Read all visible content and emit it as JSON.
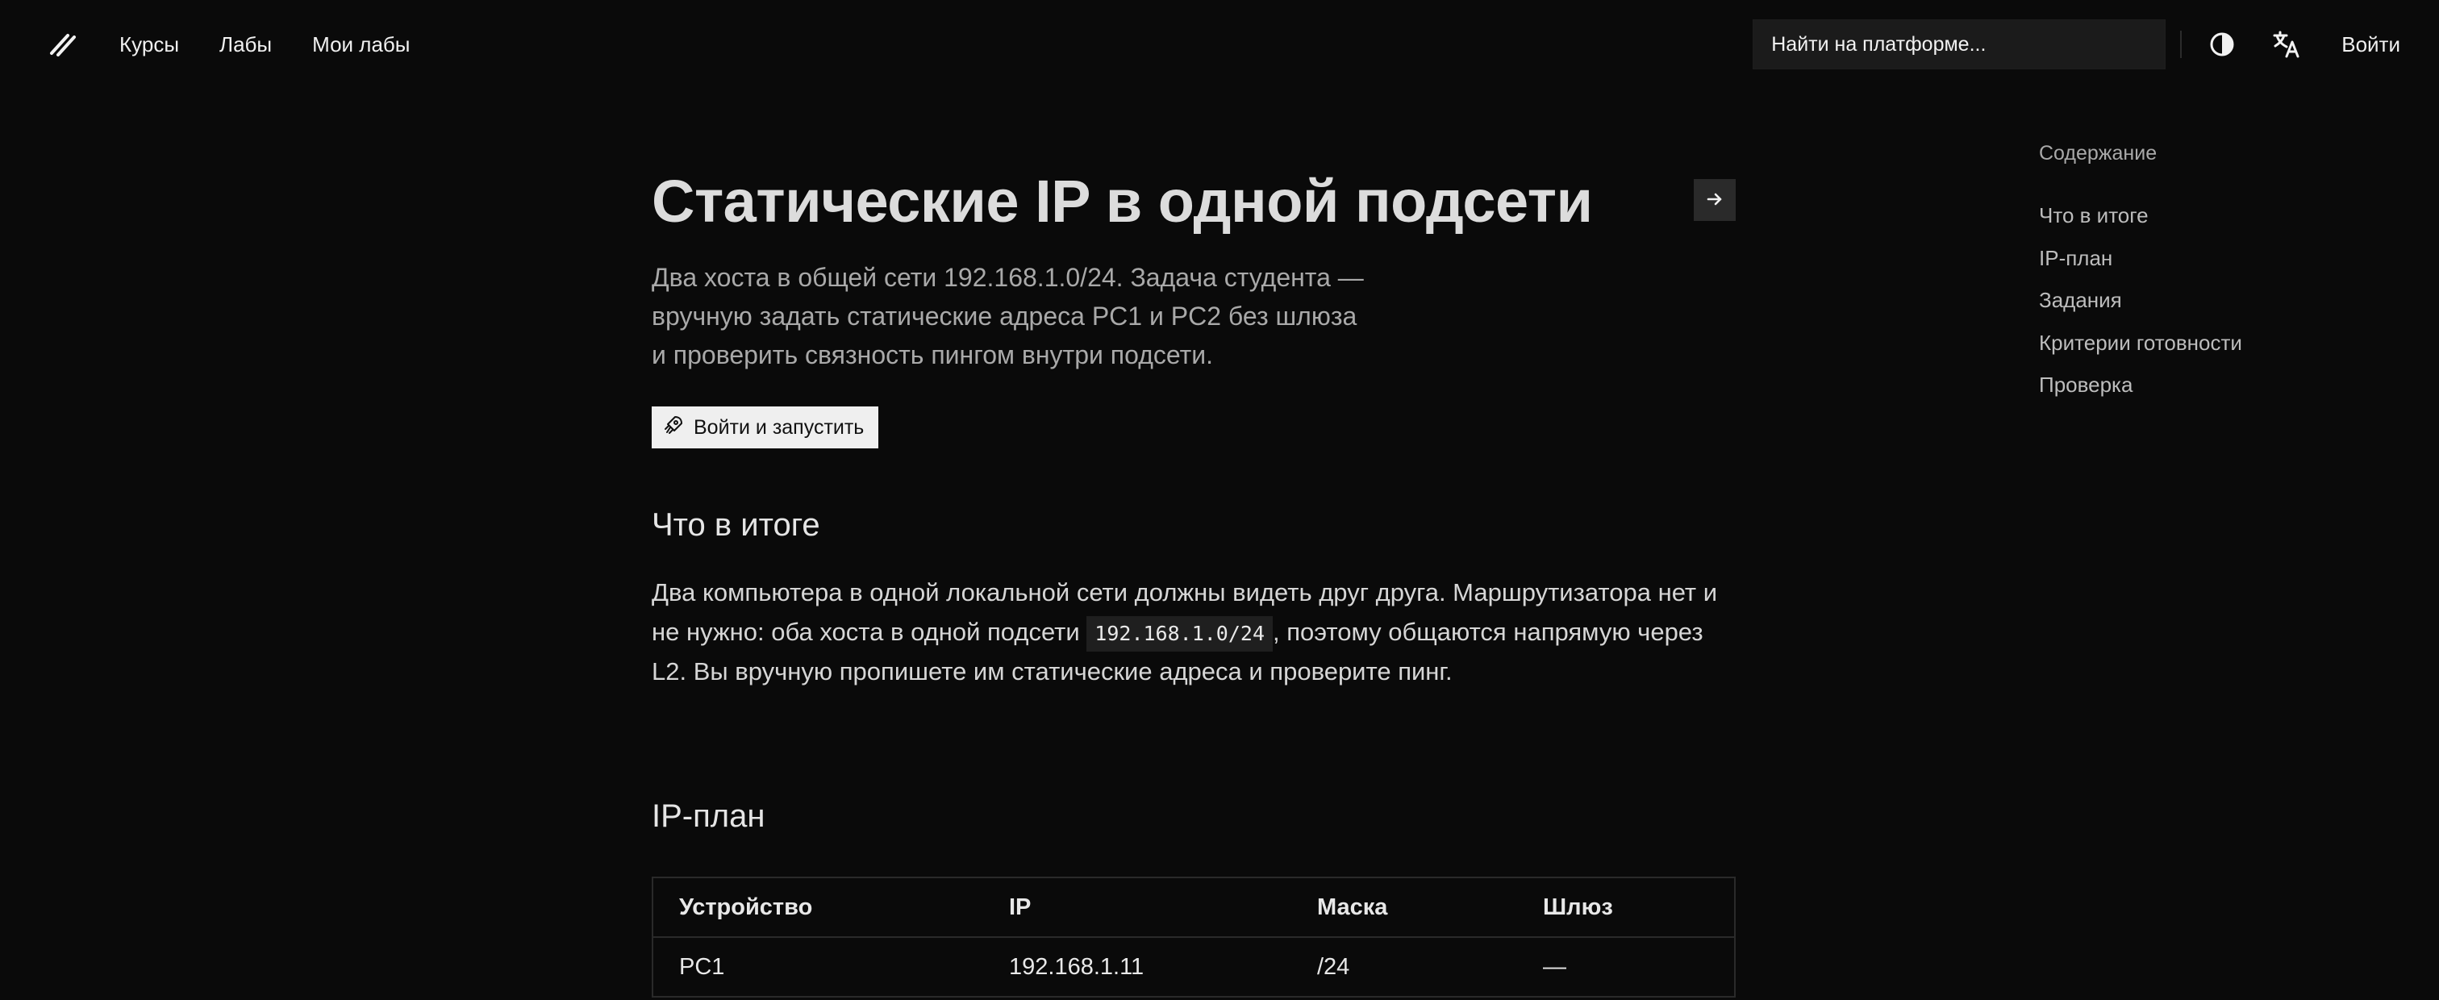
{
  "header": {
    "nav": [
      "Курсы",
      "Лабы",
      "Мои лабы"
    ],
    "search_placeholder": "Найти на платформе...",
    "signin_label": "Войти",
    "icons": {
      "logo": "slash-logo-icon",
      "theme": "contrast-icon",
      "language": "translate-icon"
    }
  },
  "page": {
    "title": "Статические IP в одной подсети",
    "lead": "Два хоста в общей сети 192.168.1.0/24. Задача студента — вручную задать статические адреса PC1 и PC2 без шлюза и проверить связность пингом внутри подсети.",
    "cta_label": "Войти и запустить",
    "section1_heading": "Что в итоге",
    "section1_text_a": "Два компьютера в одной локальной сети должны видеть друг друга. Маршрутизатора нет и не нужно: оба хоста в одной подсети ",
    "section1_code": "192.168.1.0/24",
    "section1_text_b": ", поэтому общаются напрямую через L2. Вы вручную пропишете им статические адреса и проверите пинг.",
    "section2_heading": "IP-план",
    "table": {
      "headers": [
        "Устройство",
        "IP",
        "Маска",
        "Шлюз"
      ],
      "rows": [
        [
          "PC1",
          "192.168.1.11",
          "/24",
          "—"
        ]
      ]
    }
  },
  "toc": {
    "title": "Содержание",
    "items": [
      "Что в итоге",
      "IP-план",
      "Задания",
      "Критерии готовности",
      "Проверка"
    ]
  },
  "colors": {
    "background": "#0a0a0a",
    "text": "#e6e6e6",
    "muted": "#a9a9a9",
    "button_bg": "#efefef"
  }
}
